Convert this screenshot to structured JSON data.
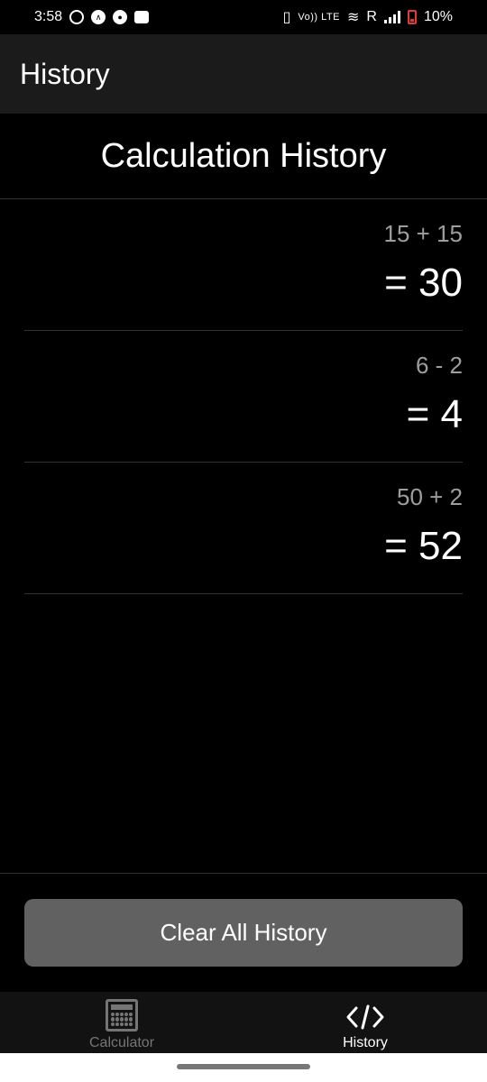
{
  "status_bar": {
    "time": "3:58",
    "network_type": "Vo)) LTE",
    "roaming": "R",
    "battery": "10%",
    "icons": [
      "whatsapp-icon",
      "a-app-icon",
      "circle-app-icon",
      "notification-app-icon",
      "vibrate-icon",
      "volte-icon",
      "wifi-icon",
      "signal-icon",
      "battery-low-icon"
    ]
  },
  "app_bar": {
    "title": "History"
  },
  "page": {
    "title": "Calculation History"
  },
  "history": [
    {
      "expression": "15 + 15",
      "result": "= 30"
    },
    {
      "expression": "6 - 2",
      "result": "= 4"
    },
    {
      "expression": "50 + 2",
      "result": "= 52"
    }
  ],
  "actions": {
    "clear_label": "Clear All History"
  },
  "bottom_nav": {
    "items": [
      {
        "label": "Calculator",
        "icon": "calculator-icon",
        "active": false
      },
      {
        "label": "History",
        "icon": "code-icon",
        "active": true
      }
    ]
  },
  "colors": {
    "background": "#000000",
    "app_bar": "#1b1b1b",
    "button": "#616161",
    "muted_text": "#9e9e9e",
    "battery_low": "#e53935"
  }
}
